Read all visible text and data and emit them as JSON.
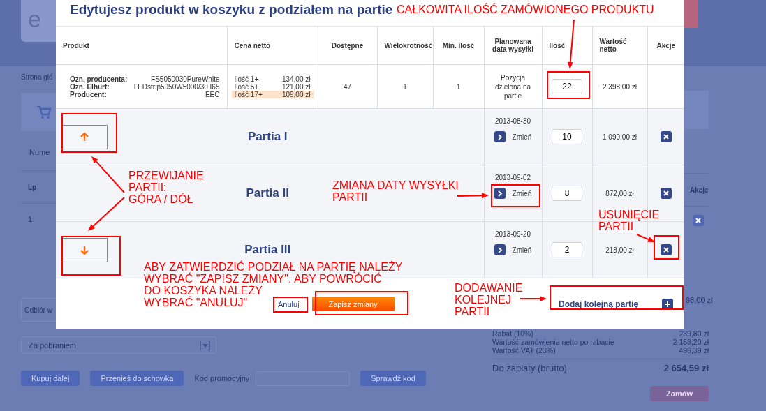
{
  "background_page": {
    "logo_letter": "e",
    "breadcrumb": "Strona głó",
    "section_label": "Nume",
    "table_columns": [
      "Lp"
    ],
    "row_number": "1",
    "right_column": "Akcje",
    "delivery_field": "Odbiór w",
    "subtotal_tail": "98,00 zł",
    "payment_select": "Za pobraniem",
    "buttons": [
      "Kupuj dalej",
      "Przenieś do schowka"
    ],
    "promo_label": "Kod promocyjny",
    "promo_button": "Sprawdź kod",
    "summary": [
      {
        "label": "Rabat (10%)",
        "value": "239,80 zł"
      },
      {
        "label": "Wartość zamówienia netto po rabacie",
        "value": "2 158,20 zł"
      },
      {
        "label": "Wartość VAT (23%)",
        "value": "496,39 zł"
      }
    ],
    "total": {
      "label": "Do zapłaty (brutto)",
      "value": "2 654,59 zł"
    },
    "order_button": "Zamów"
  },
  "dialog": {
    "title": "Edytujesz produkt w koszyku z podziałem na partie",
    "columns": [
      "Produkt",
      "Cena netto",
      "Dostępne",
      "Wielokrotność",
      "Min. ilość",
      "Planowana data wysyłki",
      "Ilość",
      "Wartość netto",
      "Akcje"
    ],
    "product": {
      "details": [
        {
          "label": "Ozn. producenta:",
          "value": "FS5050030PureWhite"
        },
        {
          "label": "Ozn. Elhurt:",
          "value": "LEDstrip5050W5000/30 I65"
        },
        {
          "label": "Producent:",
          "value": "EEC"
        }
      ],
      "prices": [
        {
          "label": "Ilość 1+",
          "price": "134,00 zł",
          "selected": false
        },
        {
          "label": "Ilość 5+",
          "price": "121,00 zł",
          "selected": false
        },
        {
          "label": "Ilość 17+",
          "price": "109,00 zł",
          "selected": true
        }
      ],
      "available": "47",
      "multiple": "1",
      "min": "1",
      "shipping": "Pozycja dzielona na partie",
      "quantity": "22",
      "value": "2 398,00 zł"
    },
    "batches": [
      {
        "name": "Partia I",
        "kind": "up",
        "date": "2013-08-30",
        "change": "Zmień",
        "quantity": "10",
        "value": "1 090,00 zł"
      },
      {
        "name": "Partia II",
        "kind": "none",
        "date": "2013-09-02",
        "change": "Zmień",
        "quantity": "8",
        "value": "872,00 zł"
      },
      {
        "name": "Partia III",
        "kind": "down",
        "date": "2013-09-20",
        "change": "Zmień",
        "quantity": "2",
        "value": "218,00 zł"
      }
    ],
    "cancel": "Anuluj",
    "save": "Zapisz zmiany",
    "add_batch": "Dodaj kolejną partię"
  },
  "annotations": [
    {
      "lines": [
        "CAŁKOWITA ILOŚĆ ZAMÓWIONEGO PRODUKTU"
      ]
    },
    {
      "lines": [
        "PRZEWIJANIE",
        "PARTII:",
        "GÓRA / DÓŁ"
      ]
    },
    {
      "lines": [
        "ZMIANA DATY WYSYŁKI",
        "PARTII"
      ]
    },
    {
      "lines": [
        "USUNIĘCIE",
        "PARTII"
      ]
    },
    {
      "lines": [
        "ABY ZATWIERDZIĆ PODZIAŁ NA PARTIĘ NALEŻY",
        "WYBRAĆ \"ZAPISZ ZMIANY\". ABY POWRÓCIĆ"
      ]
    },
    {
      "lines": [
        "DO KOSZYKA NALEŻY",
        "WYBRAĆ \"ANULUJ\""
      ]
    },
    {
      "lines": [
        "DODAWANIE",
        "KOLEJNEJ",
        "PARTII"
      ]
    }
  ]
}
